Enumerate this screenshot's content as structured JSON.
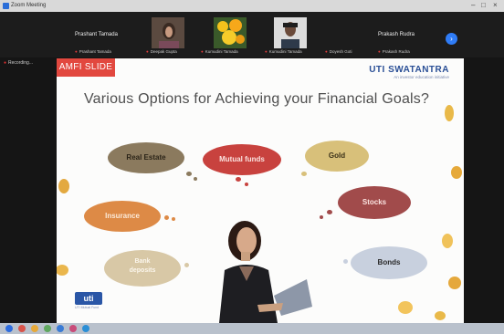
{
  "window": {
    "title": "Zoom Meeting"
  },
  "participants": [
    {
      "name": "Prashant Tamada",
      "sub": "Prashant Tamada"
    },
    {
      "name": "",
      "sub": "Deepak Gupta"
    },
    {
      "name": "",
      "sub": "Kumudini Tamada"
    },
    {
      "name": "",
      "sub": "Kumudini Tamada"
    },
    {
      "name": "",
      "sub": "Doyesh Goti"
    },
    {
      "name": "Prakash Rudra",
      "sub": "Prakash Rudra"
    }
  ],
  "recording": "Recording...",
  "slide": {
    "tag": "AMFI SLIDE",
    "brand": "UTI SWATANTRA",
    "brand_tagline": "An investor education initiative",
    "title": "Various Options for Achieving your Financial Goals?",
    "options": [
      {
        "label": "Real Estate",
        "color": "#8b7a5e"
      },
      {
        "label": "Mutual funds",
        "color": "#c8423e"
      },
      {
        "label": "Gold",
        "color": "#d8c07a"
      },
      {
        "label": "Insurance",
        "color": "#dd8a46"
      },
      {
        "label": "Stocks",
        "color": "#a14b4b"
      },
      {
        "label": "Bank deposits",
        "color": "#d8c8a6"
      },
      {
        "label": "Bonds",
        "color": "#c8d0de"
      }
    ],
    "logo": "uti",
    "logo_sub": "UTI Mutual Fund"
  },
  "colors": {
    "accent": "#e2483f",
    "brand": "#2a4f96",
    "sync": "#2f7cf6"
  }
}
